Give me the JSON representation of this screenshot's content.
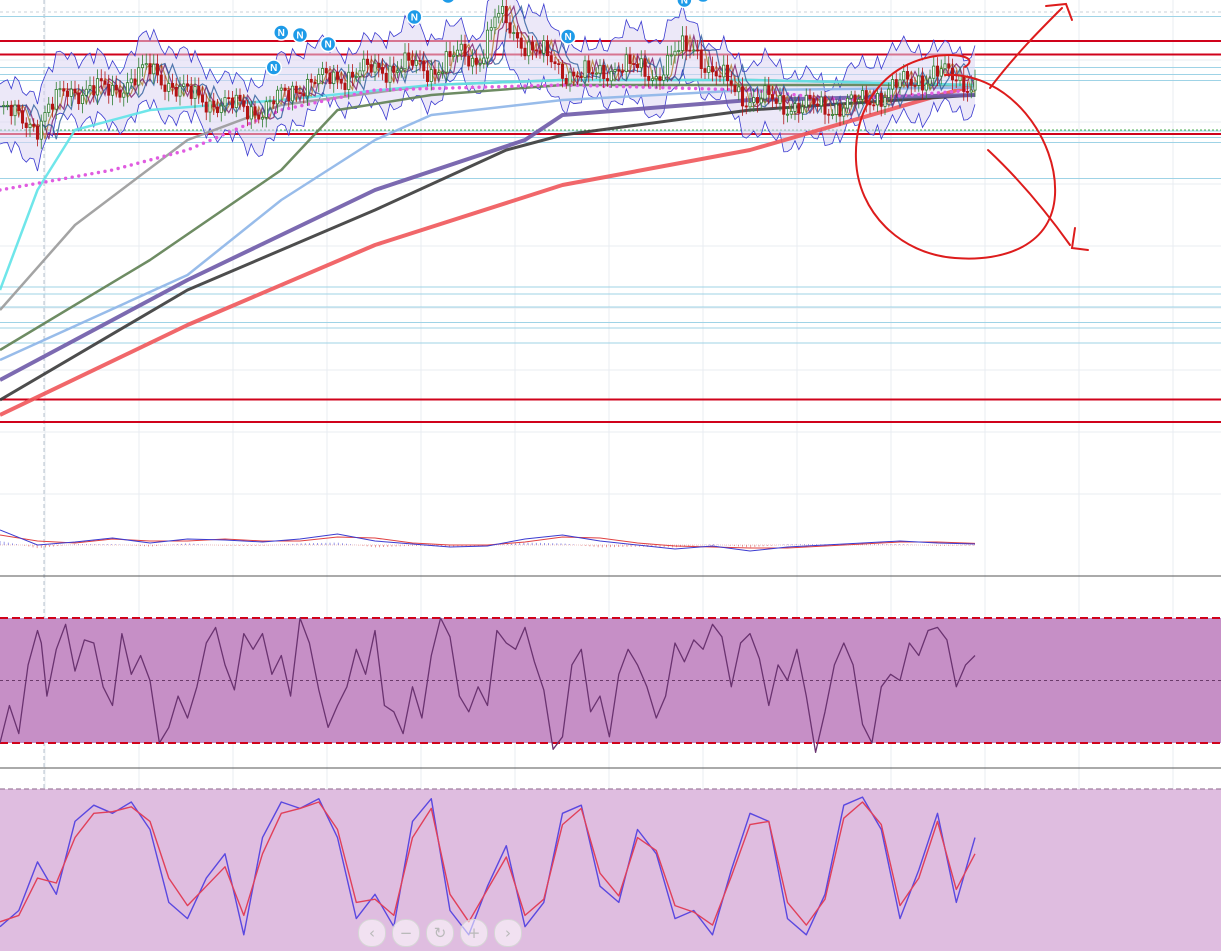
{
  "colors": {
    "background": "#ffffff",
    "grid": "#e8ecf2",
    "hline_red": "#d0021b",
    "hline_blue": "#9fd3e6",
    "ma_red": "#f0575a",
    "ma_dark": "#3a3a3a",
    "ma_purple": "#6e5aa8",
    "ma_lightblue": "#8db5e8",
    "ma_green": "#5e7f52",
    "ma_gray": "#9a9a9a",
    "ma_cyan": "#5fe3e8",
    "ma_magenta_dots": "#e05ce0",
    "bb_band": "#3b3bd0",
    "bb_fill": "#dcd6f2",
    "candle_up": "#2f7d2f",
    "candle_down": "#b31515",
    "news_badge": "#1e9be8",
    "macd_line": "#3b3bd0",
    "macd_signal": "#e04040",
    "rsi_line": "#6a3370",
    "rsi_band_fill": "#c68fc6",
    "rsi_band_border": "#d0021b",
    "stoch_k": "#5a48e0",
    "stoch_d": "#e0405a",
    "stoch_fill": "#dfbde0",
    "annotation": "#dd1c1c"
  },
  "news_badge_label": "N",
  "nav_controls": [
    {
      "name": "scroll-left-button",
      "icon": "chevron-left-icon",
      "glyph": "‹"
    },
    {
      "name": "zoom-out-button",
      "icon": "minus-icon",
      "glyph": "−"
    },
    {
      "name": "reset-chart-button",
      "icon": "reset-icon",
      "glyph": "↻"
    },
    {
      "name": "zoom-in-button",
      "icon": "plus-icon",
      "glyph": "+"
    },
    {
      "name": "scroll-right-button",
      "icon": "chevron-right-icon",
      "glyph": "›"
    }
  ],
  "chart_data": [
    {
      "type": "candlestick",
      "panel": "price",
      "title": "",
      "xlabel": "",
      "ylabel": "",
      "ylim": [
        0,
        100
      ],
      "grid": true,
      "legend": "none",
      "note": "",
      "horizontal_levels_red": [
        91.8,
        89.1,
        73.2,
        20.1,
        15.6
      ],
      "horizontal_levels_blue": [
        96.7,
        86.5,
        85.1,
        83.9,
        73.8,
        72.5,
        71.5,
        64.3,
        42.6,
        41.2,
        38.6,
        35.5,
        34.4,
        31.4
      ],
      "price_anchors": {
        "x": [
          0,
          20,
          35,
          60,
          80,
          100,
          120,
          140,
          160,
          185,
          200,
          215,
          230,
          245,
          255,
          265,
          275,
          285,
          300,
          315,
          330,
          340,
          350,
          360,
          370,
          380,
          390,
          400,
          410,
          420,
          440,
          460,
          480,
          500,
          520
        ],
        "y": [
          78,
          75,
          82,
          82,
          86,
          81,
          79,
          78,
          83,
          85,
          86,
          87,
          86,
          89,
          88,
          97,
          93,
          90,
          86,
          84.5,
          87,
          86,
          85,
          89,
          91,
          85,
          83,
          80,
          80,
          79,
          78.5,
          79.5,
          83,
          85.5,
          83
        ]
      },
      "news_markers_x": [
        146,
        160,
        150,
        175,
        221,
        239,
        303,
        365,
        375
      ],
      "moving_averages": [
        {
          "color_key": "ma_red",
          "x": [
            0,
            100,
            200,
            300,
            400,
            520
          ],
          "y": [
            17,
            35,
            51,
            63,
            70,
            83
          ]
        },
        {
          "color_key": "ma_dark",
          "x": [
            0,
            100,
            200,
            270,
            300,
            400,
            520
          ],
          "y": [
            20,
            42,
            58,
            70,
            73,
            78,
            81
          ]
        },
        {
          "color_key": "ma_purple",
          "x": [
            0,
            100,
            200,
            280,
            300,
            400,
            520
          ],
          "y": [
            24,
            44,
            62,
            72,
            77,
            80,
            81
          ]
        },
        {
          "color_key": "ma_lightblue",
          "x": [
            0,
            100,
            150,
            200,
            230,
            300,
            400,
            520
          ],
          "y": [
            28,
            45,
            60,
            72,
            77,
            80,
            82,
            82.5
          ]
        },
        {
          "color_key": "ma_green",
          "x": [
            0,
            80,
            150,
            180,
            230,
            300,
            400,
            520
          ],
          "y": [
            30,
            48,
            66,
            78,
            81,
            83,
            83,
            83
          ]
        },
        {
          "color_key": "ma_gray",
          "x": [
            0,
            40,
            100,
            150,
            230,
            300,
            400,
            520
          ],
          "y": [
            38,
            55,
            72,
            79,
            83,
            84,
            84,
            83
          ]
        },
        {
          "color_key": "ma_cyan",
          "x": [
            0,
            20,
            40,
            80,
            150,
            230,
            300,
            400,
            520
          ],
          "y": [
            42,
            62,
            74,
            78,
            80,
            83,
            84,
            84,
            83
          ]
        }
      ],
      "magenta_dots": {
        "x": [
          0,
          60,
          100,
          150,
          200,
          300,
          400,
          450,
          520
        ],
        "y": [
          62,
          66,
          70,
          78,
          82,
          83,
          82,
          80,
          82
        ]
      },
      "annotations": [
        {
          "kind": "circle",
          "label": ""
        },
        {
          "kind": "arrow-up",
          "label": ""
        },
        {
          "kind": "arrow-down",
          "label": ""
        }
      ]
    },
    {
      "type": "line",
      "panel": "macd",
      "title": "",
      "xlabel": "",
      "ylabel": "",
      "ylim": [
        -1,
        1
      ],
      "grid": true,
      "legend": "none",
      "series_macd": {
        "x": [
          0,
          20,
          40,
          60,
          80,
          100,
          120,
          140,
          160,
          180,
          200,
          220,
          240,
          260,
          280,
          300,
          320,
          340,
          360,
          380,
          400,
          420,
          440,
          460,
          480,
          500,
          520
        ],
        "y": [
          0.75,
          0.0,
          0.15,
          0.35,
          0.1,
          0.3,
          0.25,
          0.15,
          0.3,
          0.55,
          0.2,
          0.05,
          -0.1,
          -0.05,
          0.3,
          0.5,
          0.2,
          0.0,
          -0.2,
          -0.05,
          -0.3,
          -0.1,
          0.0,
          0.1,
          0.2,
          0.1,
          0.05
        ]
      },
      "series_signal": {
        "x": [
          0,
          20,
          40,
          60,
          80,
          100,
          120,
          140,
          160,
          180,
          200,
          220,
          240,
          260,
          280,
          300,
          320,
          340,
          360,
          380,
          400,
          420,
          440,
          460,
          480,
          500,
          520
        ],
        "y": [
          0.5,
          0.2,
          0.1,
          0.3,
          0.2,
          0.2,
          0.3,
          0.2,
          0.2,
          0.4,
          0.35,
          0.1,
          0.0,
          0.0,
          0.15,
          0.4,
          0.35,
          0.1,
          -0.05,
          -0.1,
          -0.15,
          -0.15,
          -0.05,
          0.05,
          0.15,
          0.15,
          0.08
        ]
      }
    },
    {
      "type": "line",
      "panel": "rsi",
      "title": "",
      "xlabel": "",
      "ylabel": "",
      "ylim": [
        0,
        100
      ],
      "band": [
        30,
        70
      ],
      "midline": 50,
      "grid": false,
      "legend": "none",
      "series": [
        {
          "x": [
            0,
            5,
            10,
            15,
            20,
            22,
            25,
            30,
            35,
            40,
            45,
            50,
            55,
            60,
            65,
            70,
            75,
            80,
            85,
            90,
            95,
            100,
            105,
            110,
            115,
            120,
            125,
            130,
            135,
            140,
            145,
            150,
            155,
            160,
            165,
            170,
            175,
            180,
            185,
            190,
            195,
            200,
            205,
            210,
            215,
            220,
            225,
            230,
            235,
            240,
            245,
            250,
            255,
            260,
            265,
            270,
            275,
            280,
            285,
            290,
            295,
            300,
            305,
            310,
            315,
            320,
            325,
            330,
            335,
            340,
            345,
            350,
            355,
            360,
            365,
            370,
            375,
            380,
            385,
            390,
            395,
            400,
            405,
            410,
            415,
            420,
            425,
            430,
            435,
            440,
            445,
            450,
            455,
            460,
            465,
            470,
            475,
            480,
            485,
            490,
            495,
            500,
            505,
            510,
            515,
            520
          ],
          "y": [
            30,
            42,
            33,
            55,
            66,
            62,
            45,
            60,
            68,
            53,
            63,
            62,
            48,
            42,
            65,
            52,
            58,
            50,
            30,
            35,
            45,
            38,
            48,
            62,
            67,
            55,
            47,
            65,
            60,
            65,
            52,
            58,
            45,
            70,
            62,
            47,
            35,
            42,
            48,
            60,
            52,
            66,
            42,
            40,
            33,
            48,
            38,
            58,
            70,
            64,
            45,
            40,
            48,
            42,
            66,
            62,
            60,
            67,
            56,
            47,
            28,
            32,
            55,
            60,
            40,
            45,
            32,
            52,
            60,
            55,
            48,
            38,
            45,
            62,
            56,
            63,
            60,
            68,
            64,
            48,
            62,
            65,
            57,
            42,
            55,
            50,
            60,
            45,
            27,
            40,
            55,
            62,
            55,
            36,
            30,
            48,
            52,
            50,
            62,
            58,
            66,
            67,
            63,
            48,
            55,
            58
          ]
        }
      ]
    },
    {
      "type": "line",
      "panel": "stochastic",
      "title": "",
      "xlabel": "",
      "ylabel": "",
      "ylim": [
        0,
        100
      ],
      "band": [
        20,
        80
      ],
      "grid": false,
      "legend": "none",
      "series": [
        {
          "x": [
            0,
            10,
            20,
            30,
            40,
            50,
            60,
            70,
            80,
            90,
            100,
            110,
            120,
            130,
            140,
            150,
            160,
            170,
            180,
            190,
            200,
            210,
            220,
            230,
            240,
            250,
            260,
            270,
            280,
            290,
            300,
            310,
            320,
            330,
            340,
            350,
            360,
            370,
            380,
            390,
            400,
            410,
            420,
            430,
            440,
            450,
            460,
            470,
            480,
            490,
            500,
            510,
            520
          ],
          "y": [
            15,
            25,
            55,
            35,
            80,
            90,
            85,
            92,
            75,
            30,
            20,
            45,
            60,
            10,
            70,
            92,
            88,
            94,
            70,
            20,
            35,
            15,
            80,
            94,
            25,
            10,
            40,
            65,
            15,
            30,
            85,
            90,
            40,
            30,
            75,
            60,
            20,
            25,
            10,
            50,
            85,
            80,
            20,
            10,
            35,
            90,
            95,
            75,
            20,
            50,
            85,
            30,
            70
          ]
        },
        {
          "x": [
            0,
            10,
            20,
            30,
            40,
            50,
            60,
            70,
            80,
            90,
            100,
            110,
            120,
            130,
            140,
            150,
            160,
            170,
            180,
            190,
            200,
            210,
            220,
            230,
            240,
            250,
            260,
            270,
            280,
            290,
            300,
            310,
            320,
            330,
            340,
            350,
            360,
            370,
            380,
            390,
            400,
            410,
            420,
            430,
            440,
            450,
            460,
            470,
            480,
            490,
            500,
            510,
            520
          ],
          "y": [
            18,
            22,
            45,
            42,
            70,
            85,
            86,
            89,
            80,
            45,
            28,
            40,
            52,
            22,
            60,
            85,
            88,
            92,
            75,
            30,
            32,
            22,
            70,
            88,
            35,
            18,
            38,
            58,
            22,
            32,
            78,
            88,
            48,
            34,
            70,
            62,
            28,
            24,
            16,
            46,
            78,
            80,
            30,
            16,
            32,
            82,
            92,
            78,
            28,
            45,
            80,
            38,
            60
          ]
        }
      ]
    }
  ]
}
